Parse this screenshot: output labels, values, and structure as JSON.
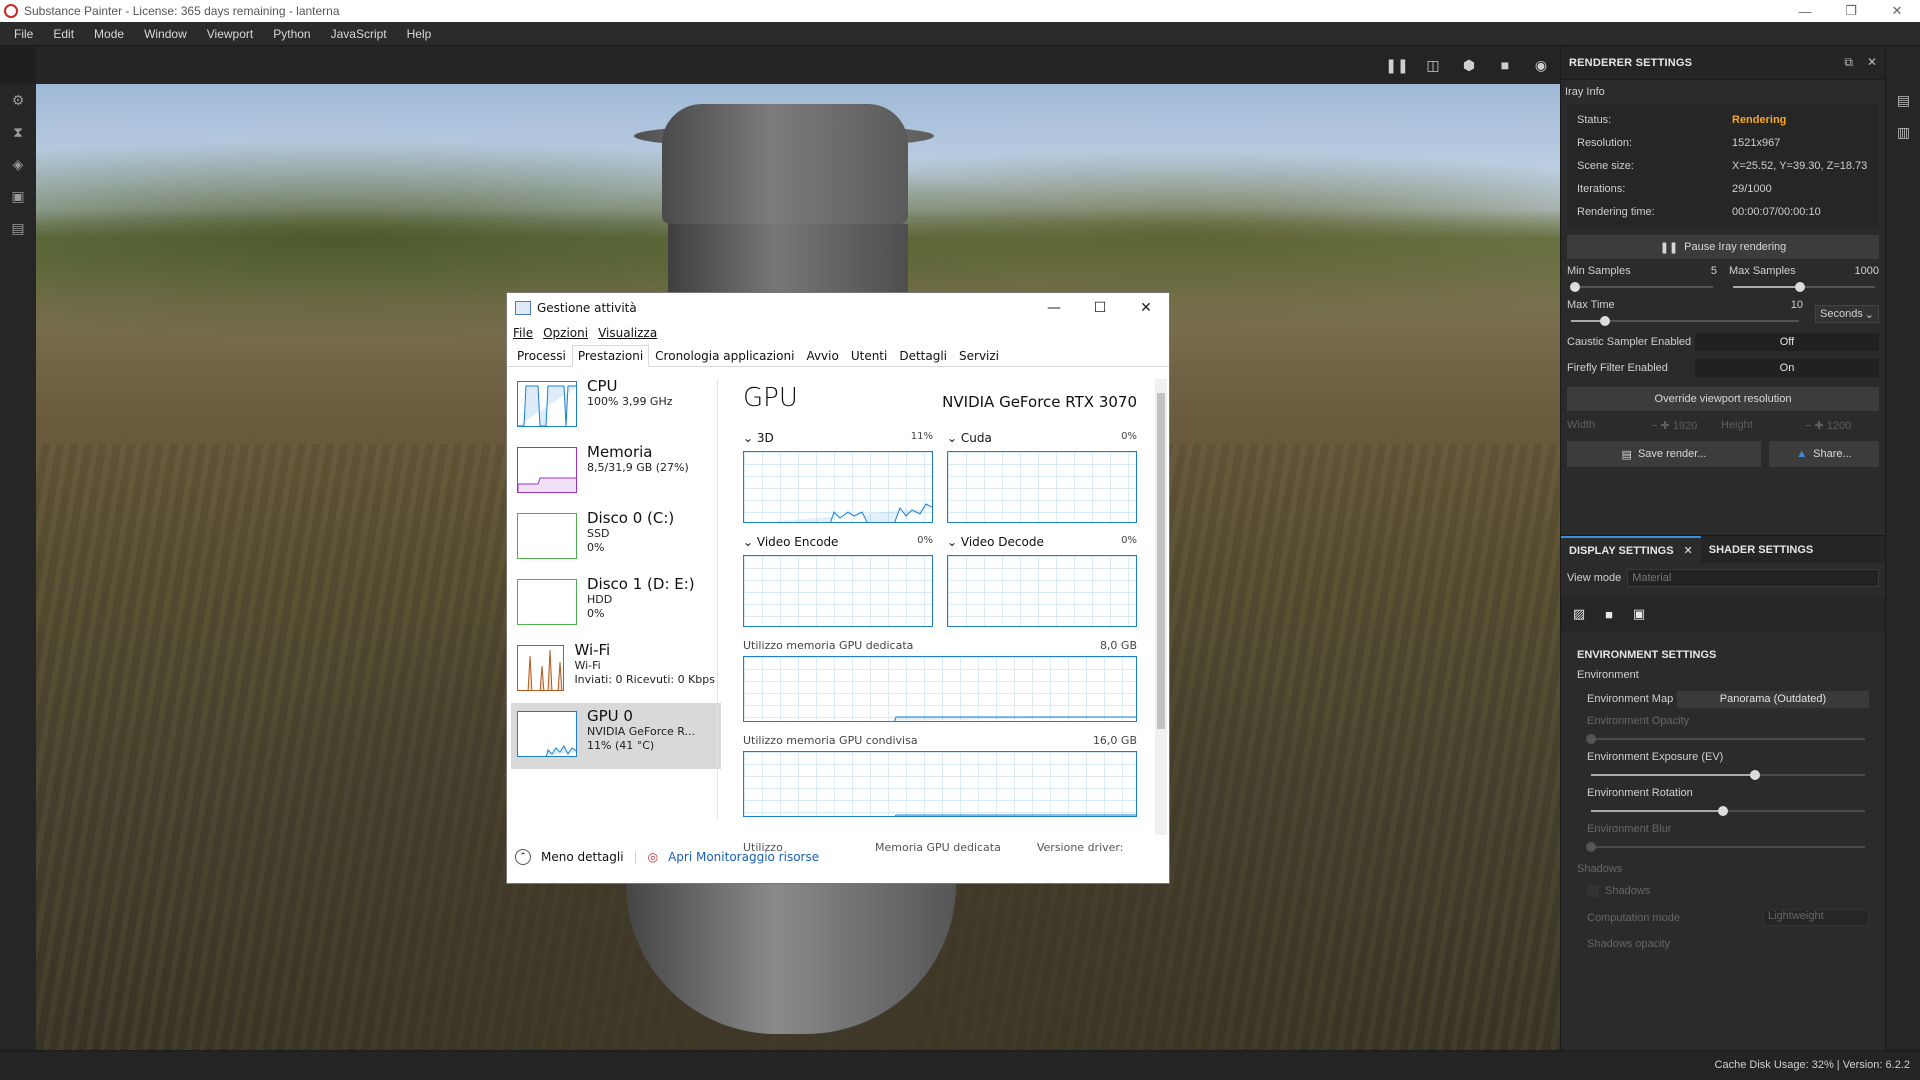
{
  "window": {
    "title": "Substance Painter - License: 365 days remaining - lanterna",
    "controls": [
      "—",
      "❐",
      "✕"
    ]
  },
  "menu": [
    "File",
    "Edit",
    "Mode",
    "Window",
    "Viewport",
    "Python",
    "JavaScript",
    "Help"
  ],
  "renderer": {
    "title": "RENDERER SETTINGS",
    "iray_info_label": "Iray Info",
    "rows": [
      {
        "k": "Status:",
        "v": "Rendering"
      },
      {
        "k": "Resolution:",
        "v": "1521x967"
      },
      {
        "k": "Scene size:",
        "v": "X=25.52, Y=39.30, Z=18.73"
      },
      {
        "k": "Iterations:",
        "v": "29/1000"
      },
      {
        "k": "Rendering time:",
        "v": "00:00:07/00:00:10"
      }
    ],
    "pause_label": "Pause Iray rendering",
    "min_samples": {
      "label": "Min Samples",
      "value": "5",
      "fraction": 0.03
    },
    "max_samples": {
      "label": "Max Samples",
      "value": "1000",
      "fraction": 0.47
    },
    "max_time": {
      "label": "Max Time",
      "value": "10",
      "fraction": 0.15,
      "unit": "Seconds"
    },
    "caustic": {
      "label": "Caustic Sampler Enabled",
      "value": "Off"
    },
    "firefly": {
      "label": "Firefly Filter Enabled",
      "value": "On"
    },
    "override_label": "Override viewport resolution",
    "width_label": "Width",
    "width_value": "1920",
    "height_label": "Height",
    "height_value": "1200",
    "save_label": "Save render...",
    "share_label": "Share..."
  },
  "display": {
    "tab1": "DISPLAY SETTINGS",
    "tab2": "SHADER SETTINGS",
    "view_mode_label": "View mode",
    "view_mode_value": "Material",
    "env_title": "ENVIRONMENT SETTINGS",
    "env_sub": "Environment",
    "env_map_label": "Environment Map",
    "env_map_value": "Panorama (Outdated)",
    "sliders": [
      {
        "label": "Environment Opacity",
        "fraction": 0.0,
        "dim": true
      },
      {
        "label": "Environment Exposure (EV)",
        "fraction": 0.6,
        "dim": false
      },
      {
        "label": "Environment Rotation",
        "fraction": 0.48,
        "dim": false
      },
      {
        "label": "Environment Blur",
        "fraction": 0.0,
        "dim": true
      }
    ],
    "shadows_sub": "Shadows",
    "shadows_label": "Shadows",
    "computation_label": "Computation mode",
    "computation_value": "Lightweight",
    "shadows_opacity_label": "Shadows opacity"
  },
  "status_bar": "Cache Disk Usage:   32%  |  Version: 6.2.2",
  "taskmgr": {
    "title": "Gestione attività",
    "menu": [
      "File",
      "Opzioni",
      "Visualizza"
    ],
    "tabs": [
      "Processi",
      "Prestazioni",
      "Cronologia applicazioni",
      "Avvio",
      "Utenti",
      "Dettagli",
      "Servizi"
    ],
    "active_tab": 1,
    "resources": [
      {
        "name": "CPU",
        "sub1": "100% 3,99 GHz",
        "sub2": "",
        "sub3": "",
        "color": "#1a7fcf"
      },
      {
        "name": "Memoria",
        "sub1": "8,5/31,9 GB (27%)",
        "sub2": "",
        "sub3": "",
        "color": "#9b33c9"
      },
      {
        "name": "Disco 0 (C:)",
        "sub1": "SSD",
        "sub2": "0%",
        "sub3": "",
        "color": "#4caf50"
      },
      {
        "name": "Disco 1 (D: E:)",
        "sub1": "HDD",
        "sub2": "0%",
        "sub3": "",
        "color": "#4caf50"
      },
      {
        "name": "Wi-Fi",
        "sub1": "Wi-Fi",
        "sub2": "Inviati: 0 Ricevuti: 0 Kbps",
        "sub3": "",
        "color": "#b25c1e"
      },
      {
        "name": "GPU 0",
        "sub1": "NVIDIA GeForce R...",
        "sub2": "11% (41 °C)",
        "sub3": "",
        "color": "#1a7fcf"
      }
    ],
    "gpu": {
      "title": "GPU",
      "model": "NVIDIA GeForce RTX 3070",
      "engines": [
        {
          "name": "3D",
          "pct": "11%"
        },
        {
          "name": "Cuda",
          "pct": "0%"
        },
        {
          "name": "Video Encode",
          "pct": "0%"
        },
        {
          "name": "Video Decode",
          "pct": "0%"
        }
      ],
      "mem_dedicated_label": "Utilizzo memoria GPU dedicata",
      "mem_dedicated_value": "8,0 GB",
      "mem_shared_label": "Utilizzo memoria GPU condivisa",
      "mem_shared_value": "16,0 GB",
      "stats": [
        "Utilizzo",
        "Memoria GPU dedicata",
        "Versione driver:"
      ]
    },
    "footer_less": "Meno dettagli",
    "footer_monitor": "Apri Monitoraggio risorse"
  }
}
